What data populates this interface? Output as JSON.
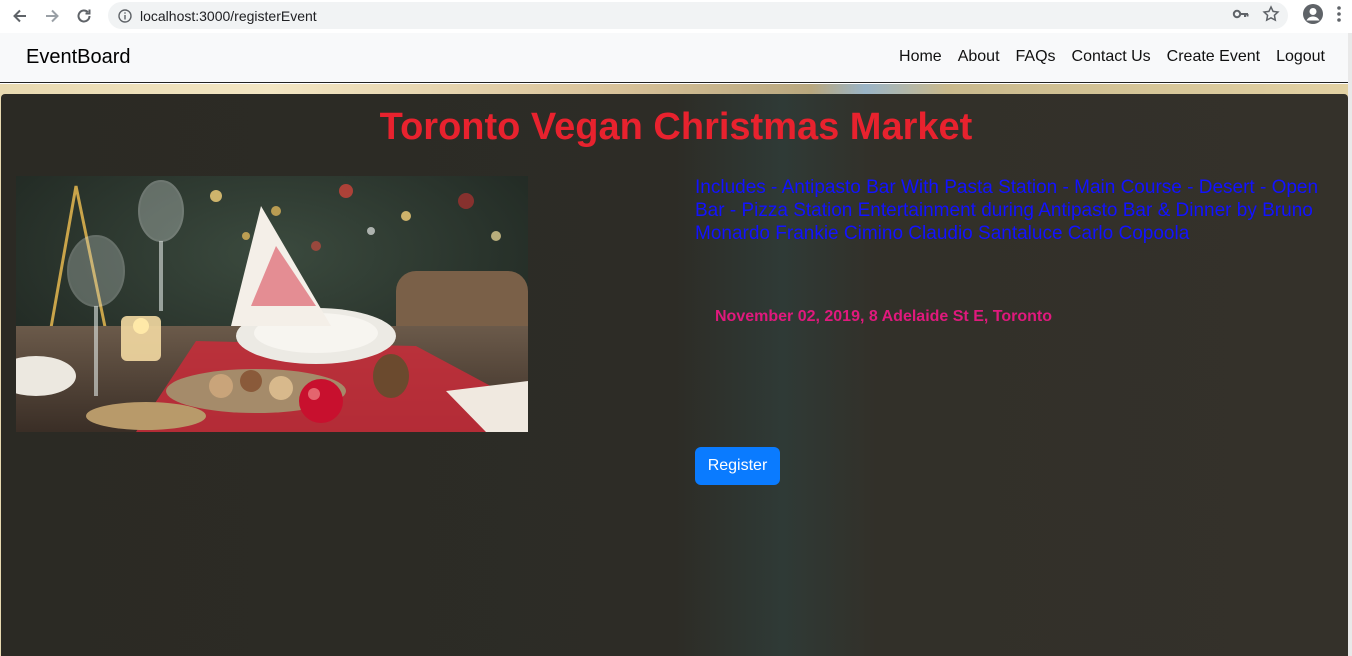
{
  "browser": {
    "url": "localhost:3000/registerEvent"
  },
  "navbar": {
    "brand": "EventBoard",
    "links": [
      "Home",
      "About",
      "FAQs",
      "Contact Us",
      "Create Event",
      "Logout"
    ]
  },
  "event": {
    "title": "Toronto Vegan Christmas Market",
    "description": "Includes - Antipasto Bar With Pasta Station - Main Course - Desert - Open Bar - Pizza Station Entertainment during Antipasto Bar & Dinner by Bruno Monardo Frankie Cimino Claudio Santaluce Carlo Copoola",
    "date_location": "November 02, 2019, 8 Adelaide St E, Toronto",
    "register_label": "Register"
  },
  "colors": {
    "title": "#e8222e",
    "description": "#1212ff",
    "info": "#e0197d",
    "button": "#0a7bff"
  }
}
